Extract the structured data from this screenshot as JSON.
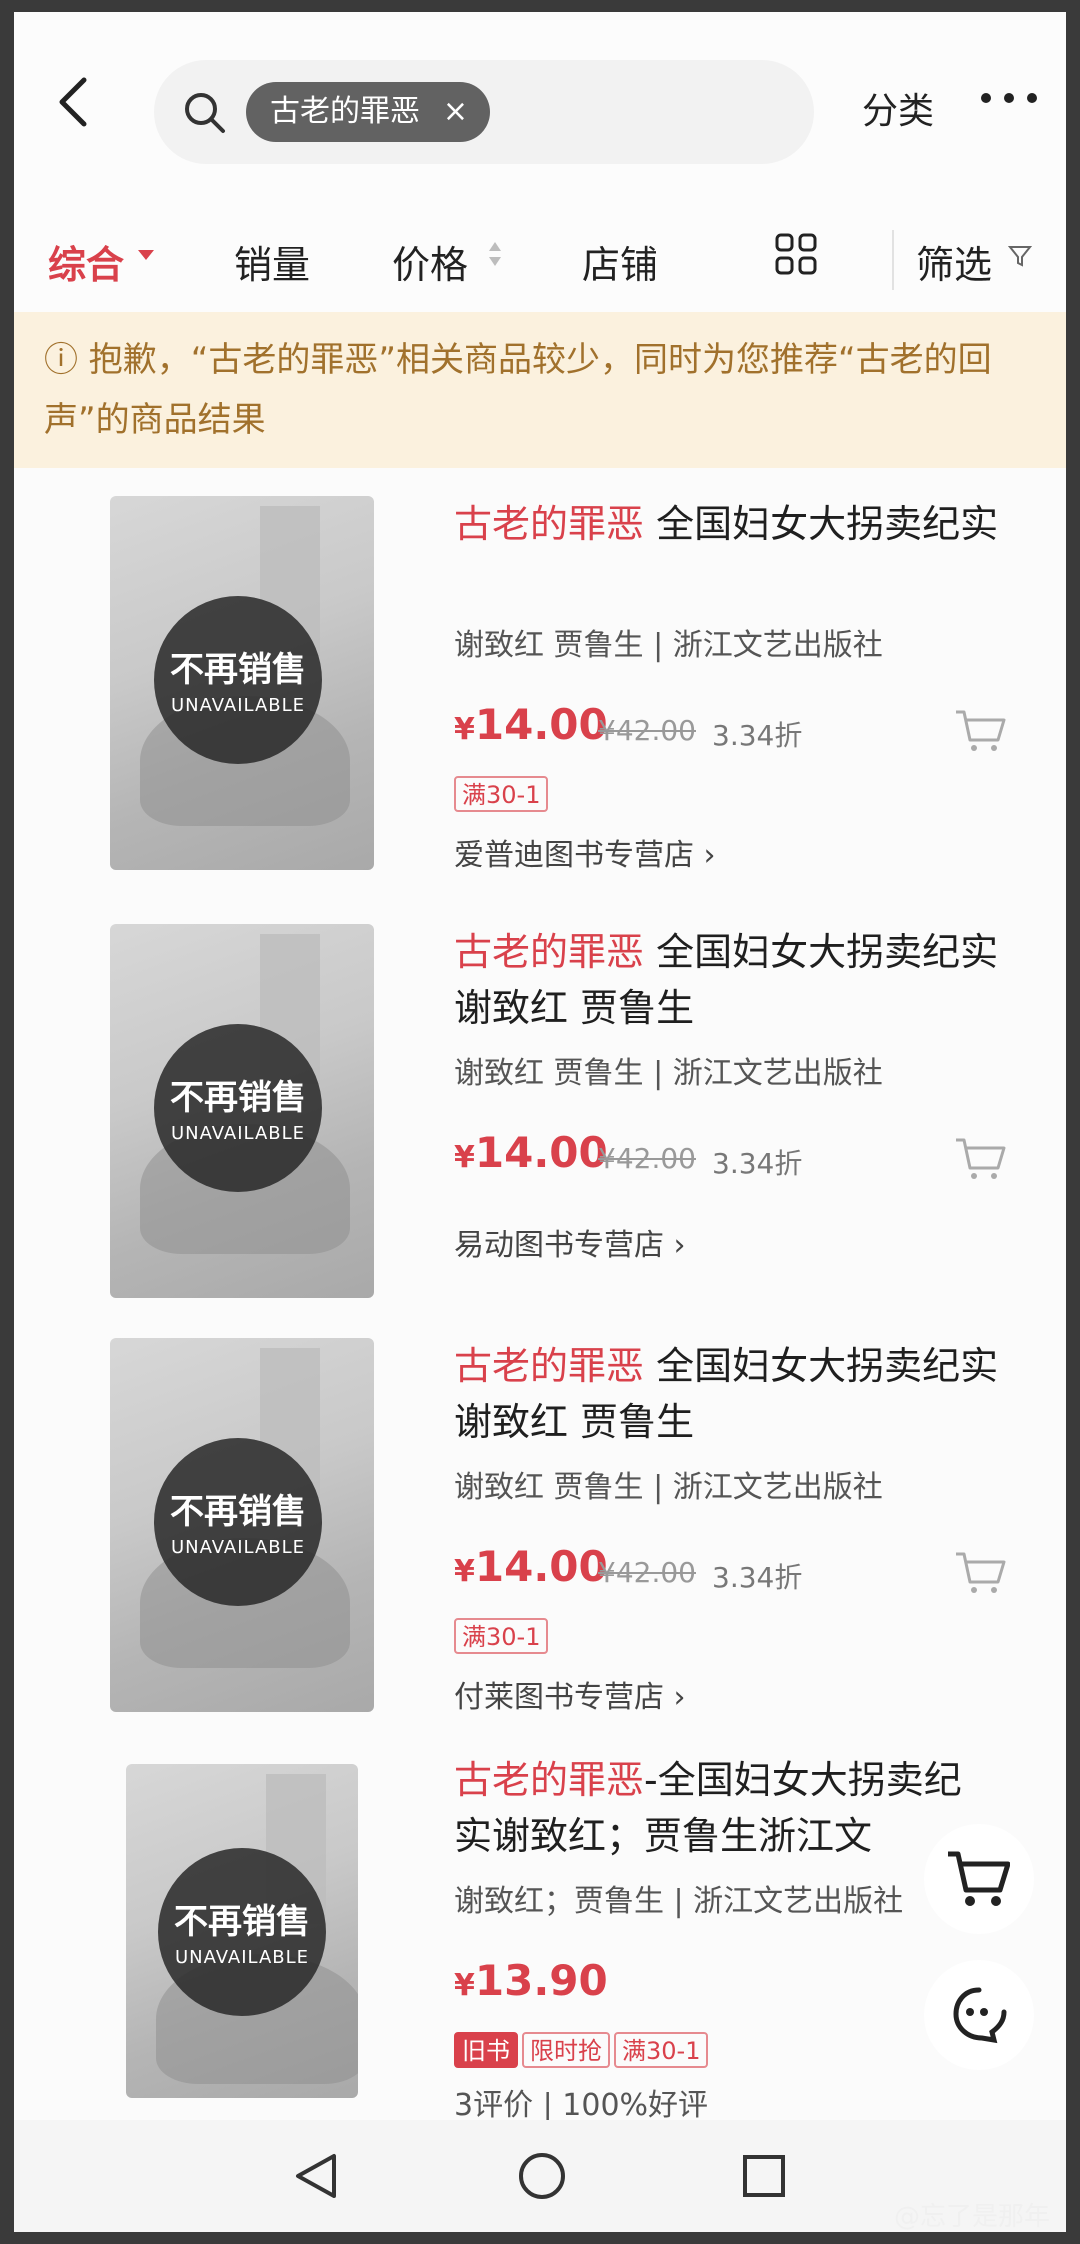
{
  "search": {
    "query": "古老的罪恶",
    "clear": "×"
  },
  "header": {
    "category_label": "分类"
  },
  "sort_tabs": {
    "all": "综合",
    "sales": "销量",
    "price": "价格",
    "shop": "店铺",
    "filter": "筛选"
  },
  "notice": {
    "text": "ⓘ 抱歉，“古老的罪恶”相关商品较少，同时为您推荐“古老的回声”的商品结果"
  },
  "products": [
    {
      "highlight": "古老的罪恶",
      "title_rest": " 全国妇女大拐卖纪实",
      "author": "谢致红 贾鲁生 | 浙江文艺出版社",
      "currency": "¥",
      "price": "14.00",
      "original": "¥42.00",
      "discount": "3.34折",
      "tag": "满30-1",
      "shop": "爱普迪图书专营店 ›",
      "badge_cn": "不再销售",
      "badge_en": "UNAVAILABLE"
    },
    {
      "highlight": "古老的罪恶",
      "title_rest": " 全国妇女大拐卖纪实 谢致红 贾鲁生",
      "author": "谢致红 贾鲁生 | 浙江文艺出版社",
      "currency": "¥",
      "price": "14.00",
      "original": "¥42.00",
      "discount": "3.34折",
      "shop": "易动图书专营店 ›",
      "badge_cn": "不再销售",
      "badge_en": "UNAVAILABLE"
    },
    {
      "highlight": "古老的罪恶",
      "title_rest": " 全国妇女大拐卖纪实 谢致红 贾鲁生",
      "author": "谢致红 贾鲁生 | 浙江文艺出版社",
      "currency": "¥",
      "price": "14.00",
      "original": "¥42.00",
      "discount": "3.34折",
      "tag": "满30-1",
      "shop": "付莱图书专营店 ›",
      "badge_cn": "不再销售",
      "badge_en": "UNAVAILABLE"
    },
    {
      "highlight": "古老的罪恶",
      "title_rest": "-全国妇女大拐卖纪实谢致红；贾鲁生浙江文",
      "author": "谢致红；贾鲁生 | 浙江文艺出版社",
      "currency": "¥",
      "price": "13.90",
      "tags": [
        "旧书",
        "限时抢",
        "满30-1"
      ],
      "reviews": "3评价 | 100%好评",
      "badge_cn": "不再销售",
      "badge_en": "UNAVAILABLE"
    }
  ],
  "watermark": "@忘了是那年",
  "colors": {
    "accent": "#d9414b",
    "notice_bg": "#fbf1de",
    "notice_text": "#a1712c"
  }
}
